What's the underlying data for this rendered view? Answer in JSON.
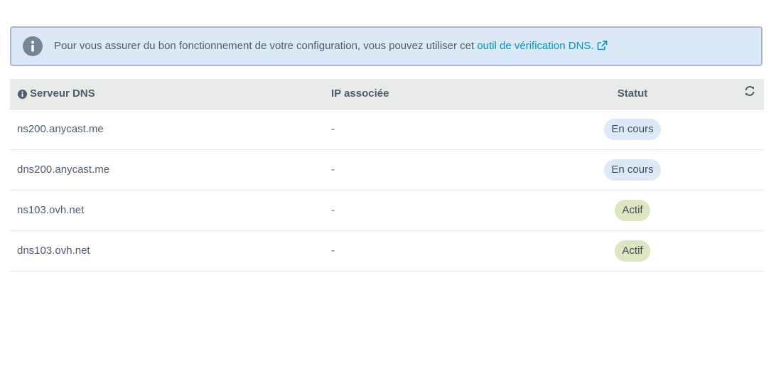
{
  "banner": {
    "text": "Pour vous assurer du bon fonctionnement de votre configuration, vous pouvez utiliser cet ",
    "link_text": "outil de vérification DNS."
  },
  "table": {
    "headers": {
      "server": "Serveur DNS",
      "ip": "IP associée",
      "status": "Statut"
    },
    "rows": [
      {
        "server": "ns200.anycast.me",
        "ip": "-",
        "status": "En cours"
      },
      {
        "server": "dns200.anycast.me",
        "ip": "-",
        "status": "En cours"
      },
      {
        "server": "ns103.ovh.net",
        "ip": "-",
        "status": "Actif"
      },
      {
        "server": "dns103.ovh.net",
        "ip": "-",
        "status": "Actif"
      }
    ]
  },
  "colors": {
    "banner_bg": "#dce9f8",
    "link": "#0098b8",
    "badge_pending": "#dce9f8",
    "badge_active": "#dde6c0"
  },
  "icons": {
    "banner": "info-circle-icon",
    "header": "info-circle-icon",
    "link": "external-link-icon",
    "refresh": "refresh-icon"
  }
}
